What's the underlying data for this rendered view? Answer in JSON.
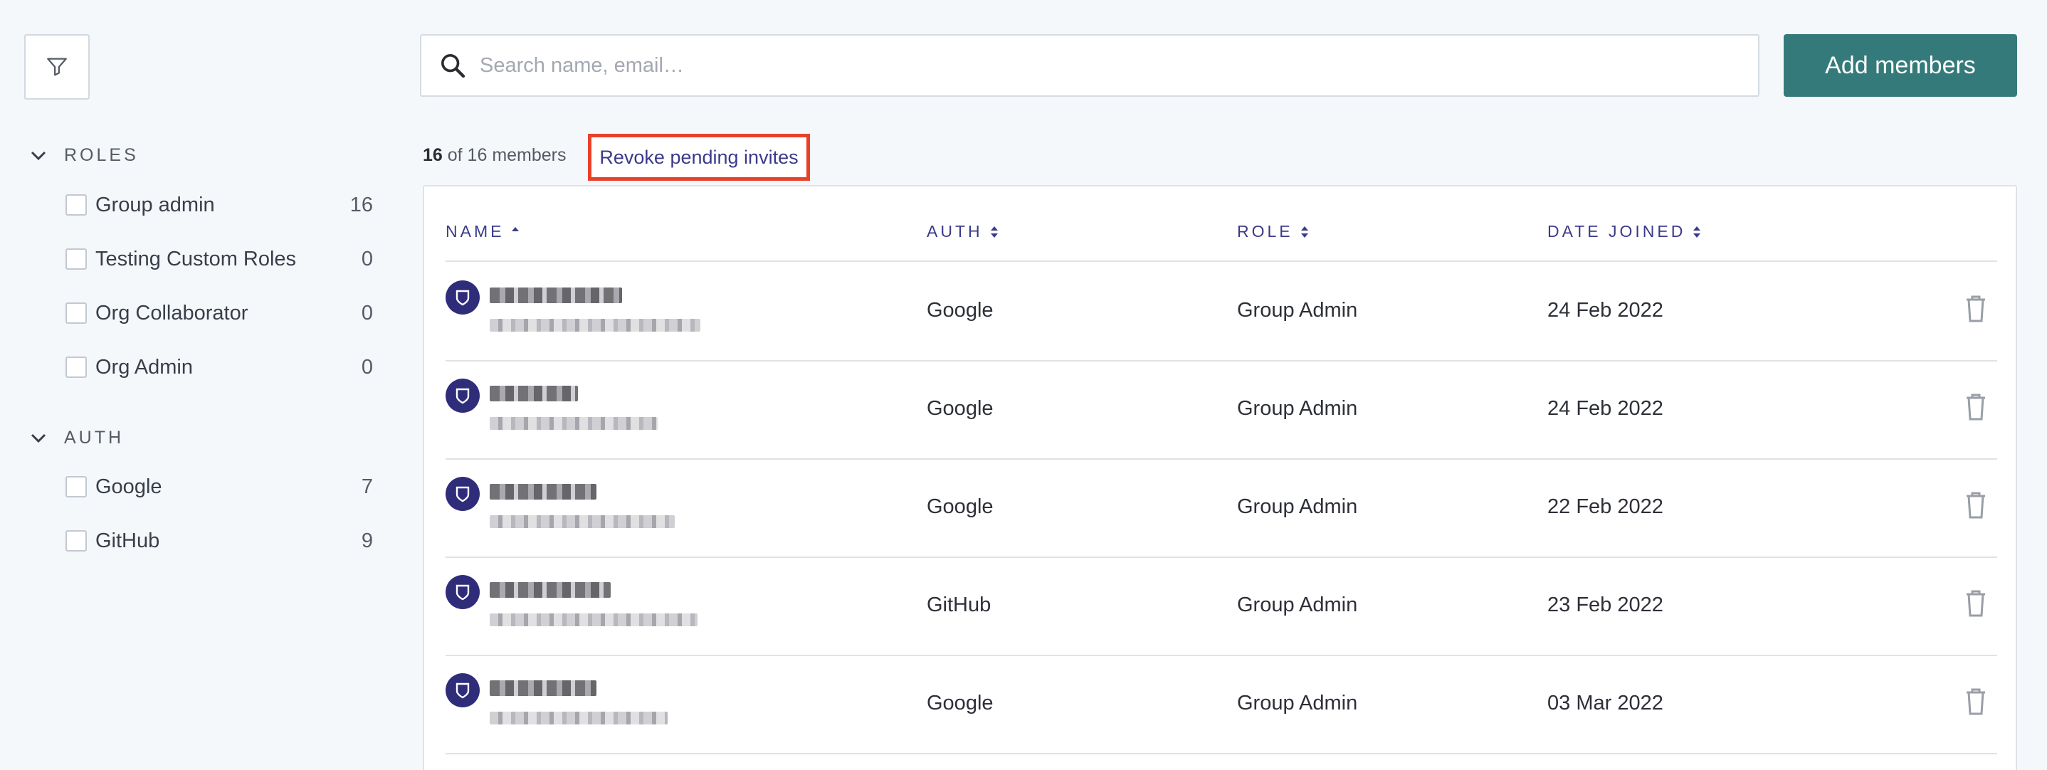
{
  "sidebar": {
    "filter_icon": "filter-icon",
    "sections": [
      {
        "title": "ROLES",
        "items": [
          {
            "label": "Group admin",
            "count": "16"
          },
          {
            "label": "Testing Custom Roles",
            "count": "0"
          },
          {
            "label": "Org Collaborator",
            "count": "0"
          },
          {
            "label": "Org Admin",
            "count": "0"
          }
        ]
      },
      {
        "title": "AUTH",
        "items": [
          {
            "label": "Google",
            "count": "7"
          },
          {
            "label": "GitHub",
            "count": "9"
          }
        ]
      }
    ]
  },
  "search": {
    "placeholder": "Search name, email…",
    "value": ""
  },
  "add_button": {
    "label": "Add members"
  },
  "summary": {
    "shown": "16",
    "rest": "of 16 members"
  },
  "revoke_link": {
    "label": "Revoke pending invites"
  },
  "table": {
    "columns": [
      {
        "label": "NAME",
        "sort": "asc"
      },
      {
        "label": "AUTH",
        "sort": "both"
      },
      {
        "label": "ROLE",
        "sort": "both"
      },
      {
        "label": "DATE JOINED",
        "sort": "both"
      }
    ],
    "rows": [
      {
        "auth": "Google",
        "role": "Group Admin",
        "date": "24 Feb 2022"
      },
      {
        "auth": "Google",
        "role": "Group Admin",
        "date": "24 Feb 2022"
      },
      {
        "auth": "Google",
        "role": "Group Admin",
        "date": "22 Feb 2022"
      },
      {
        "auth": "GitHub",
        "role": "Group Admin",
        "date": "23 Feb 2022"
      },
      {
        "auth": "Google",
        "role": "Group Admin",
        "date": "03 Mar 2022"
      }
    ]
  },
  "colors": {
    "accent": "#357a7a",
    "link": "#3b3a8a",
    "highlight": "#e8412b"
  }
}
